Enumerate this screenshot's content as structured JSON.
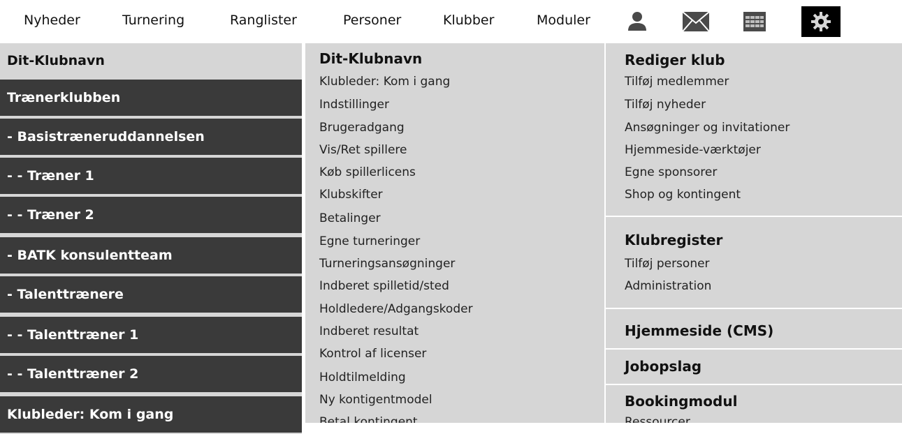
{
  "topnav": {
    "items": [
      "Nyheder",
      "Turnering",
      "Ranglister",
      "Personer",
      "Klubber",
      "Moduler"
    ],
    "icons": [
      "person-icon",
      "envelope-icon",
      "calendar-icon",
      "gear-icon"
    ]
  },
  "left_menu": {
    "items": [
      "Dit-Klubnavn",
      "Trænerklubben",
      "- Basistræneruddannelsen",
      "- - Træner 1",
      "- - Træner 2",
      "- BATK konsulentteam",
      "- Talenttrænere",
      "- - Talenttræner 1",
      "- - Talenttræner 2",
      "Klubleder: Kom i gang"
    ]
  },
  "middle_menu": {
    "heading": "Dit-Klubnavn",
    "links": [
      "Klubleder: Kom i gang",
      "Indstillinger",
      "Brugeradgang",
      "Vis/Ret spillere",
      "Køb spillerlicens",
      "Klubskifter",
      "Betalinger",
      "Egne turneringer",
      "Turneringsansøgninger",
      "Indberet spilletid/sted",
      "Holdledere/Adgangskoder",
      "Indberet resultat",
      "Kontrol af licenser",
      "Holdtilmelding",
      "Ny kontigentmodel",
      "Betal kontingent"
    ]
  },
  "right_menu": {
    "rediger_heading": "Rediger klub",
    "rediger_links": [
      "Tilføj medlemmer",
      "Tilføj nyheder",
      "Ansøgninger og invitationer",
      "Hjemmeside-værktøjer",
      "Egne sponsorer",
      "Shop og kontingent"
    ],
    "klubregister_heading": "Klubregister",
    "klubregister_links": [
      "Tilføj personer",
      "Administration"
    ],
    "cms_heading": "Hjemmeside (CMS)",
    "jobopslag_heading": "Jobopslag",
    "booking_heading": "Bookingmodul",
    "booking_links": [
      "Ressourcer"
    ]
  }
}
